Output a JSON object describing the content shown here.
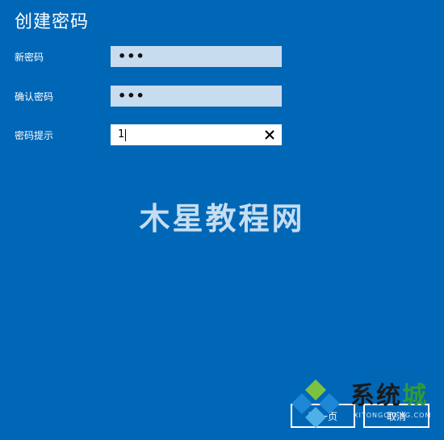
{
  "dialog": {
    "title": "创建密码"
  },
  "fields": {
    "new_password": {
      "label": "新密码",
      "value": "•••"
    },
    "confirm_password": {
      "label": "确认密码",
      "value": "•••"
    },
    "password_hint": {
      "label": "密码提示",
      "value": "1"
    }
  },
  "buttons": {
    "next_label": "下一页",
    "cancel_label": "取消"
  },
  "watermarks": {
    "center_text": "木星教程网",
    "logo_text_main": "系统",
    "logo_text_accent": "城",
    "logo_sub": "XITONGCHENG.COM"
  },
  "colors": {
    "background": "#0067b7",
    "field_inactive": "#c7dcef",
    "field_active": "#ffffff",
    "logo_green": "#2f9a3a",
    "logo_blue": "#1e88d6"
  },
  "icons": {
    "clear": "close-icon",
    "logo": "diamond-logo-icon"
  }
}
